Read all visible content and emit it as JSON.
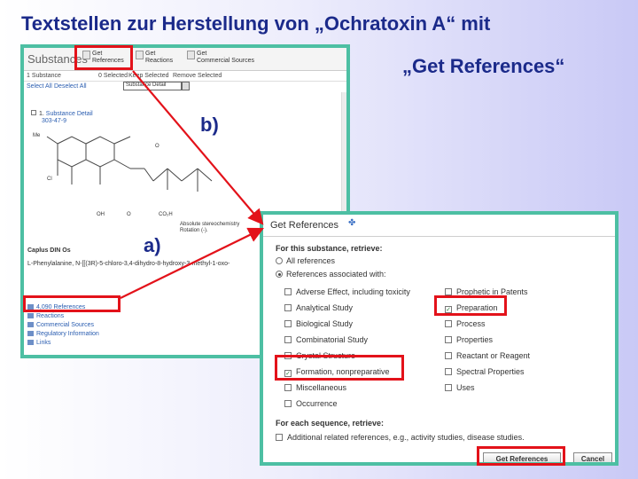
{
  "slide": {
    "title_line1": "Textstellen zur Herstellung von „Ochratoxin A“ mit",
    "title_line2": "„Get References“",
    "label_a": "a)",
    "label_b": "b)"
  },
  "substance_window": {
    "heading": "Substances",
    "toolbar": [
      {
        "label": "Get\nReferences"
      },
      {
        "label": "Get\nReactions"
      },
      {
        "label": "Get\nCommercial Sources"
      }
    ],
    "bar2": [
      "1 Substance",
      "0 Selected",
      "Keep Selected",
      "Remove Selected"
    ],
    "bar3": [
      "Select All",
      "Deselect All"
    ],
    "select_value": "Substance Detail",
    "detail_index": "1.",
    "detail_label": "Substance Detail",
    "cas": "303-47-9",
    "atoms": [
      "Me",
      "O",
      "Cl",
      "OH",
      "O",
      "CO₂H"
    ],
    "stereo_note": "Absolute stereochemistry\nRotation (-).",
    "cin_heading": "Caplus DIN Os",
    "name_line": "L-Phenylalanine, N-[[(3R)-5-chloro-3,4-dihydro-8-hydroxy-3-methyl-1-oxo-",
    "links": [
      "4,090 References",
      "Reactions",
      "Commercial Sources",
      "Regulatory Information",
      "Links"
    ]
  },
  "get_references": {
    "title": "Get References",
    "help_icon": "help-icon",
    "for_substance": "For this substance, retrieve:",
    "radio_all": "All references",
    "radio_assoc": "References associated with:",
    "col1": [
      {
        "label": "Adverse Effect, including toxicity",
        "checked": false
      },
      {
        "label": "Analytical Study",
        "checked": false
      },
      {
        "label": "Biological Study",
        "checked": false
      },
      {
        "label": "Combinatorial Study",
        "checked": false
      },
      {
        "label": "Crystal Structure",
        "checked": false
      },
      {
        "label": "Formation, nonpreparative",
        "checked": true
      },
      {
        "label": "Miscellaneous",
        "checked": false
      },
      {
        "label": "Occurrence",
        "checked": false
      }
    ],
    "col2": [
      {
        "label": "Prophetic in Patents",
        "checked": false
      },
      {
        "label": "Preparation",
        "checked": true
      },
      {
        "label": "Process",
        "checked": false
      },
      {
        "label": "Properties",
        "checked": false
      },
      {
        "label": "Reactant or Reagent",
        "checked": false
      },
      {
        "label": "Spectral Properties",
        "checked": false
      },
      {
        "label": "Uses",
        "checked": false
      }
    ],
    "for_sequence": "For each sequence, retrieve:",
    "additional": "Additional related references, e.g., activity studies, disease studies.",
    "btn_get": "Get References",
    "btn_cancel": "Cancel"
  },
  "colors": {
    "highlight": "#e3121a",
    "title": "#1b2a8a",
    "frame": "#4dbfa3"
  }
}
